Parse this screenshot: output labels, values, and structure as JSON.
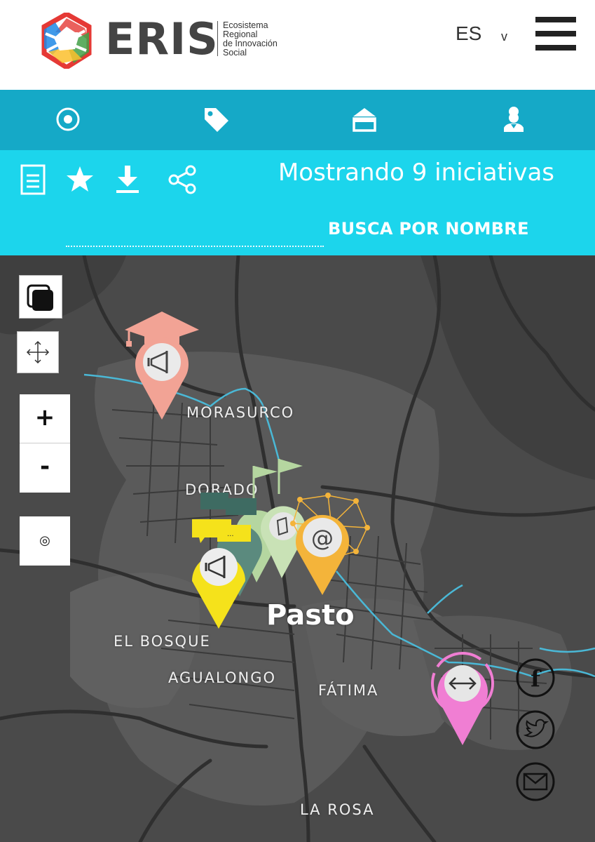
{
  "header": {
    "brand": "ERIS",
    "tagline_lines": [
      "Ecosistema",
      "Regional",
      "de Innovación",
      "Social"
    ],
    "language": "ES",
    "language_chevron": "v"
  },
  "nav": {
    "items": [
      "radio-target-icon",
      "tag-icon",
      "archive-box-icon",
      "user-icon"
    ]
  },
  "toolbar": {
    "tools": [
      "document-icon",
      "star-icon",
      "download-icon",
      "share-icon"
    ],
    "count_text": "Mostrando 9 iniciativas",
    "search_label": "BUSCA POR NOMBRE"
  },
  "map": {
    "controls": {
      "layers": "layers-icon",
      "fullscreen": "move-arrows-icon",
      "zoom_in": "+",
      "zoom_out": "-",
      "locate": "◎"
    },
    "places": {
      "morasurco": "MORASURCO",
      "dorado": "DORADO",
      "pasto": "Pasto",
      "el_bosque": "EL BOSQUE",
      "agualongo": "AGUALONGO",
      "fatima": "FÁTIMA",
      "la_rosa": "LA ROSA"
    },
    "markers": [
      {
        "category": "education",
        "icon": "megaphone-icon",
        "color": "#f2a395"
      },
      {
        "category": "community",
        "icon": "megaphone-icon",
        "color": "#f5e21b"
      },
      {
        "category": "network",
        "icon": "at-sign-icon",
        "color": "#f4b43a"
      },
      {
        "category": "flag",
        "icon": "flag-icon",
        "color": "#b5d6a0"
      },
      {
        "category": "exchange",
        "icon": "exchange-arrows-icon",
        "color": "#f07ed3"
      }
    ],
    "marker_at_label": "@",
    "marker_chat_label": "..."
  },
  "social": [
    "facebook-icon",
    "twitter-icon",
    "mail-icon"
  ],
  "social_labels": {
    "facebook": "f"
  },
  "colors": {
    "nav": "#15a9c7",
    "toolbar": "#1cd5ec",
    "map_bg": "#4a4a4a",
    "river": "#4ab8d6"
  }
}
